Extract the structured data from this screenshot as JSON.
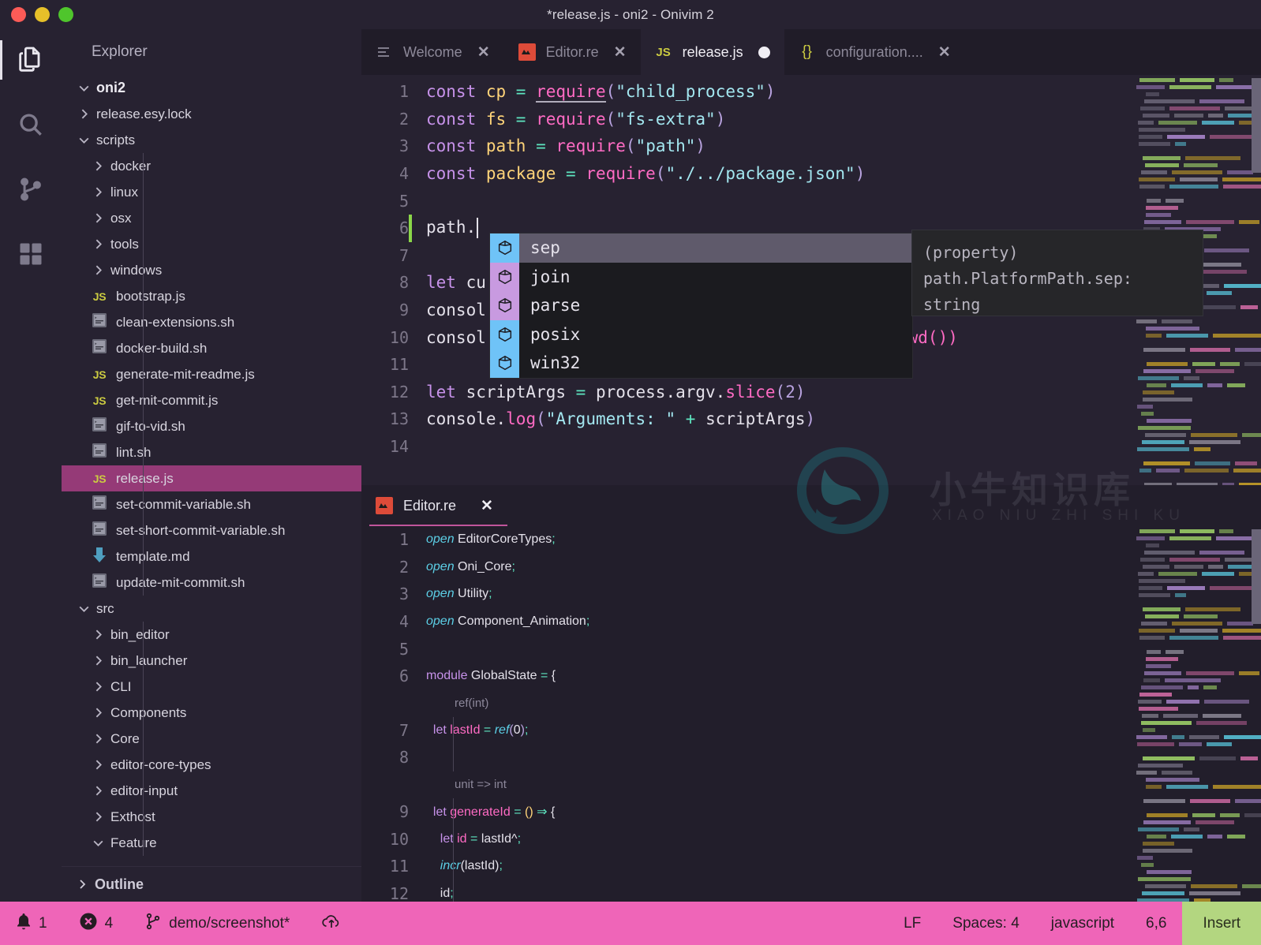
{
  "window": {
    "title": "*release.js - oni2 - Onivim 2",
    "traffic": [
      "close",
      "minimize",
      "maximize"
    ]
  },
  "activitybar": {
    "items": [
      {
        "name": "files-icon",
        "label": "Explorer",
        "active": true
      },
      {
        "name": "search-icon",
        "label": "Search",
        "active": false
      },
      {
        "name": "source-control-icon",
        "label": "Source Control",
        "active": false
      },
      {
        "name": "extensions-icon",
        "label": "Extensions",
        "active": false
      }
    ]
  },
  "sidebar": {
    "header": "Explorer",
    "outline_label": "Outline",
    "tree": [
      {
        "label": "oni2",
        "depth": 0,
        "kind": "folder",
        "expanded": true,
        "root": true
      },
      {
        "label": "release.esy.lock",
        "depth": 1,
        "kind": "folder",
        "expanded": false
      },
      {
        "label": "scripts",
        "depth": 1,
        "kind": "folder",
        "expanded": true
      },
      {
        "label": "docker",
        "depth": 2,
        "kind": "folder",
        "expanded": false
      },
      {
        "label": "linux",
        "depth": 2,
        "kind": "folder",
        "expanded": false
      },
      {
        "label": "osx",
        "depth": 2,
        "kind": "folder",
        "expanded": false
      },
      {
        "label": "tools",
        "depth": 2,
        "kind": "folder",
        "expanded": false
      },
      {
        "label": "windows",
        "depth": 2,
        "kind": "folder",
        "expanded": false
      },
      {
        "label": "bootstrap.js",
        "depth": 2,
        "kind": "js"
      },
      {
        "label": "clean-extensions.sh",
        "depth": 2,
        "kind": "sh"
      },
      {
        "label": "docker-build.sh",
        "depth": 2,
        "kind": "sh"
      },
      {
        "label": "generate-mit-readme.js",
        "depth": 2,
        "kind": "js"
      },
      {
        "label": "get-mit-commit.js",
        "depth": 2,
        "kind": "js"
      },
      {
        "label": "gif-to-vid.sh",
        "depth": 2,
        "kind": "sh"
      },
      {
        "label": "lint.sh",
        "depth": 2,
        "kind": "sh"
      },
      {
        "label": "release.js",
        "depth": 2,
        "kind": "js",
        "selected": true
      },
      {
        "label": "set-commit-variable.sh",
        "depth": 2,
        "kind": "sh"
      },
      {
        "label": "set-short-commit-variable.sh",
        "depth": 2,
        "kind": "sh"
      },
      {
        "label": "template.md",
        "depth": 2,
        "kind": "md"
      },
      {
        "label": "update-mit-commit.sh",
        "depth": 2,
        "kind": "sh"
      },
      {
        "label": "src",
        "depth": 1,
        "kind": "folder",
        "expanded": true
      },
      {
        "label": "bin_editor",
        "depth": 2,
        "kind": "folder",
        "expanded": false
      },
      {
        "label": "bin_launcher",
        "depth": 2,
        "kind": "folder",
        "expanded": false
      },
      {
        "label": "CLI",
        "depth": 2,
        "kind": "folder",
        "expanded": false
      },
      {
        "label": "Components",
        "depth": 2,
        "kind": "folder",
        "expanded": false
      },
      {
        "label": "Core",
        "depth": 2,
        "kind": "folder",
        "expanded": false
      },
      {
        "label": "editor-core-types",
        "depth": 2,
        "kind": "folder",
        "expanded": false
      },
      {
        "label": "editor-input",
        "depth": 2,
        "kind": "folder",
        "expanded": false
      },
      {
        "label": "Exthost",
        "depth": 2,
        "kind": "folder",
        "expanded": false
      },
      {
        "label": "Feature",
        "depth": 2,
        "kind": "folder",
        "expanded": true
      }
    ]
  },
  "tabs": [
    {
      "label": "Welcome",
      "icon": "lines-icon",
      "active": false,
      "close": "✕"
    },
    {
      "label": "Editor.re",
      "icon": "reason-icon",
      "active": false,
      "close": "✕"
    },
    {
      "label": "release.js",
      "icon": "js-icon",
      "active": true,
      "modified": true
    },
    {
      "label": "configuration....",
      "icon": "json-icon",
      "active": false,
      "close": "✕"
    }
  ],
  "editor_top": {
    "lines": [
      {
        "n": "1",
        "segments": [
          {
            "t": "const ",
            "c": "kw"
          },
          {
            "t": "cp",
            "c": "var"
          },
          {
            "t": " = ",
            "c": "op"
          },
          {
            "t": "require",
            "c": "fn-underline"
          },
          {
            "t": "(",
            "c": "paren"
          },
          {
            "t": "\"child_process\"",
            "c": "str"
          },
          {
            "t": ")",
            "c": "paren"
          }
        ]
      },
      {
        "n": "2",
        "segments": [
          {
            "t": "const ",
            "c": "kw"
          },
          {
            "t": "fs",
            "c": "var"
          },
          {
            "t": " = ",
            "c": "op"
          },
          {
            "t": "require",
            "c": "fn"
          },
          {
            "t": "(",
            "c": "paren"
          },
          {
            "t": "\"fs-extra\"",
            "c": "str"
          },
          {
            "t": ")",
            "c": "paren"
          }
        ]
      },
      {
        "n": "3",
        "segments": [
          {
            "t": "const ",
            "c": "kw"
          },
          {
            "t": "path",
            "c": "var"
          },
          {
            "t": " = ",
            "c": "op"
          },
          {
            "t": "require",
            "c": "fn"
          },
          {
            "t": "(",
            "c": "paren"
          },
          {
            "t": "\"path\"",
            "c": "str"
          },
          {
            "t": ")",
            "c": "paren"
          }
        ]
      },
      {
        "n": "4",
        "segments": [
          {
            "t": "const ",
            "c": "kw"
          },
          {
            "t": "package",
            "c": "var"
          },
          {
            "t": " = ",
            "c": "op"
          },
          {
            "t": "require",
            "c": "fn"
          },
          {
            "t": "(",
            "c": "paren"
          },
          {
            "t": "\"./../package.json\"",
            "c": "str"
          },
          {
            "t": ")",
            "c": "paren"
          }
        ]
      },
      {
        "n": "5",
        "segments": []
      },
      {
        "n": "6",
        "segments": [
          {
            "t": "path.",
            "c": "plain"
          }
        ],
        "cursor": true
      },
      {
        "n": "7",
        "segments": []
      },
      {
        "n": "8",
        "segments": [
          {
            "t": "let ",
            "c": "kw"
          },
          {
            "t": "cu",
            "c": "plain"
          }
        ]
      },
      {
        "n": "9",
        "segments": [
          {
            "t": "consol",
            "c": "plain"
          }
        ]
      },
      {
        "n": "10",
        "segments": [
          {
            "t": "consol",
            "c": "plain"
          }
        ],
        "tail": "cwd())"
      },
      {
        "n": "11",
        "segments": []
      },
      {
        "n": "12",
        "segments": [
          {
            "t": "let ",
            "c": "kw"
          },
          {
            "t": "scriptArgs",
            "c": "plain"
          },
          {
            "t": " = ",
            "c": "op"
          },
          {
            "t": "process.argv.",
            "c": "plain"
          },
          {
            "t": "slice",
            "c": "fn"
          },
          {
            "t": "(",
            "c": "paren"
          },
          {
            "t": "2",
            "c": "num"
          },
          {
            "t": ")",
            "c": "paren"
          }
        ]
      },
      {
        "n": "13",
        "segments": [
          {
            "t": "console.",
            "c": "plain"
          },
          {
            "t": "log",
            "c": "fn"
          },
          {
            "t": "(",
            "c": "paren"
          },
          {
            "t": "\"Arguments: \"",
            "c": "str"
          },
          {
            "t": " + ",
            "c": "op"
          },
          {
            "t": "scriptArgs",
            "c": "plain"
          },
          {
            "t": ")",
            "c": "paren"
          }
        ]
      },
      {
        "n": "14",
        "segments": []
      }
    ]
  },
  "completion": {
    "items": [
      {
        "label": "sep",
        "icon": "property-cube-icon",
        "color": "blue",
        "selected": true
      },
      {
        "label": "join",
        "icon": "method-cube-icon",
        "color": "purple",
        "selected": false
      },
      {
        "label": "parse",
        "icon": "method-cube-icon",
        "color": "purple",
        "selected": false
      },
      {
        "label": "posix",
        "icon": "property-cube-icon",
        "color": "blue",
        "selected": false
      },
      {
        "label": "win32",
        "icon": "property-cube-icon",
        "color": "blue",
        "selected": false
      }
    ],
    "doc": [
      "(property)",
      "path.PlatformPath.sep:",
      "string"
    ]
  },
  "editor_bottom": {
    "tab": {
      "label": "Editor.re",
      "icon": "reason-icon",
      "close": "✕"
    },
    "lines": [
      {
        "n": "1",
        "segments": [
          {
            "t": "open ",
            "c": "type-italic"
          },
          {
            "t": "EditorCoreTypes",
            "c": "plain"
          },
          {
            "t": ";",
            "c": "op"
          }
        ]
      },
      {
        "n": "2",
        "segments": [
          {
            "t": "open ",
            "c": "type-italic"
          },
          {
            "t": "Oni_Core",
            "c": "plain"
          },
          {
            "t": ";",
            "c": "op"
          }
        ]
      },
      {
        "n": "3",
        "segments": [
          {
            "t": "open ",
            "c": "type-italic"
          },
          {
            "t": "Utility",
            "c": "plain"
          },
          {
            "t": ";",
            "c": "op"
          }
        ]
      },
      {
        "n": "4",
        "segments": [
          {
            "t": "open ",
            "c": "type-italic"
          },
          {
            "t": "Component_Animation",
            "c": "plain"
          },
          {
            "t": ";",
            "c": "op"
          }
        ]
      },
      {
        "n": "5",
        "segments": []
      },
      {
        "n": "6",
        "segments": [
          {
            "t": "module ",
            "c": "kw"
          },
          {
            "t": "GlobalState",
            "c": "plain"
          },
          {
            "t": " = ",
            "c": "op"
          },
          {
            "t": "{",
            "c": "plain"
          }
        ]
      },
      {
        "n": "",
        "codelens": "ref(int)"
      },
      {
        "n": "7",
        "segments": [
          {
            "t": "  let ",
            "c": "kw"
          },
          {
            "t": "lastId",
            "c": "fn"
          },
          {
            "t": " = ",
            "c": "op"
          },
          {
            "t": "ref",
            "c": "type-italic"
          },
          {
            "t": "(",
            "c": "paren"
          },
          {
            "t": "0",
            "c": "plain"
          },
          {
            "t": ")",
            "c": "paren"
          },
          {
            "t": ";",
            "c": "op"
          }
        ],
        "block": true
      },
      {
        "n": "8",
        "segments": [],
        "block": true
      },
      {
        "n": "",
        "codelens": "unit => int"
      },
      {
        "n": "9",
        "segments": [
          {
            "t": "  let ",
            "c": "kw"
          },
          {
            "t": "generateId",
            "c": "fn"
          },
          {
            "t": " = ",
            "c": "op"
          },
          {
            "t": "(",
            "c": "var"
          },
          {
            "t": ")",
            "c": "var"
          },
          {
            "t": " ⇒ ",
            "c": "op"
          },
          {
            "t": "{",
            "c": "plain"
          }
        ],
        "block": true
      },
      {
        "n": "10",
        "segments": [
          {
            "t": "    let ",
            "c": "kw"
          },
          {
            "t": "id",
            "c": "fn"
          },
          {
            "t": " = ",
            "c": "op"
          },
          {
            "t": "lastId^",
            "c": "plain"
          },
          {
            "t": ";",
            "c": "op"
          }
        ],
        "block": true
      },
      {
        "n": "11",
        "segments": [
          {
            "t": "    incr",
            "c": "type-italic"
          },
          {
            "t": "(",
            "c": "plain"
          },
          {
            "t": "lastId",
            "c": "plain"
          },
          {
            "t": ")",
            "c": "plain"
          },
          {
            "t": ";",
            "c": "op"
          }
        ],
        "block": true
      },
      {
        "n": "12",
        "segments": [
          {
            "t": "    id",
            "c": "plain"
          },
          {
            "t": ";",
            "c": "op"
          }
        ],
        "block": true
      }
    ]
  },
  "watermark": {
    "cn": "小牛知识库",
    "pinyin": "XIAO NIU ZHI SHI KU"
  },
  "statusbar": {
    "notifications": {
      "icon": "bell-icon",
      "count": "1"
    },
    "problems": {
      "icon": "error-circle-icon",
      "count": "4"
    },
    "branch": {
      "icon": "git-branch-icon",
      "label": "demo/screenshot*"
    },
    "sync": {
      "icon": "cloud-upload-icon"
    },
    "line_ending": "LF",
    "indent": "Spaces: 4",
    "language": "javascript",
    "position": "6,6",
    "mode": "Insert"
  },
  "colors": {
    "accent_pink": "#ef65b8",
    "mode_green": "#b3d680",
    "selection_magenta": "#953a77",
    "sidebar_bg": "#272231",
    "editor_bg": "#272231"
  }
}
